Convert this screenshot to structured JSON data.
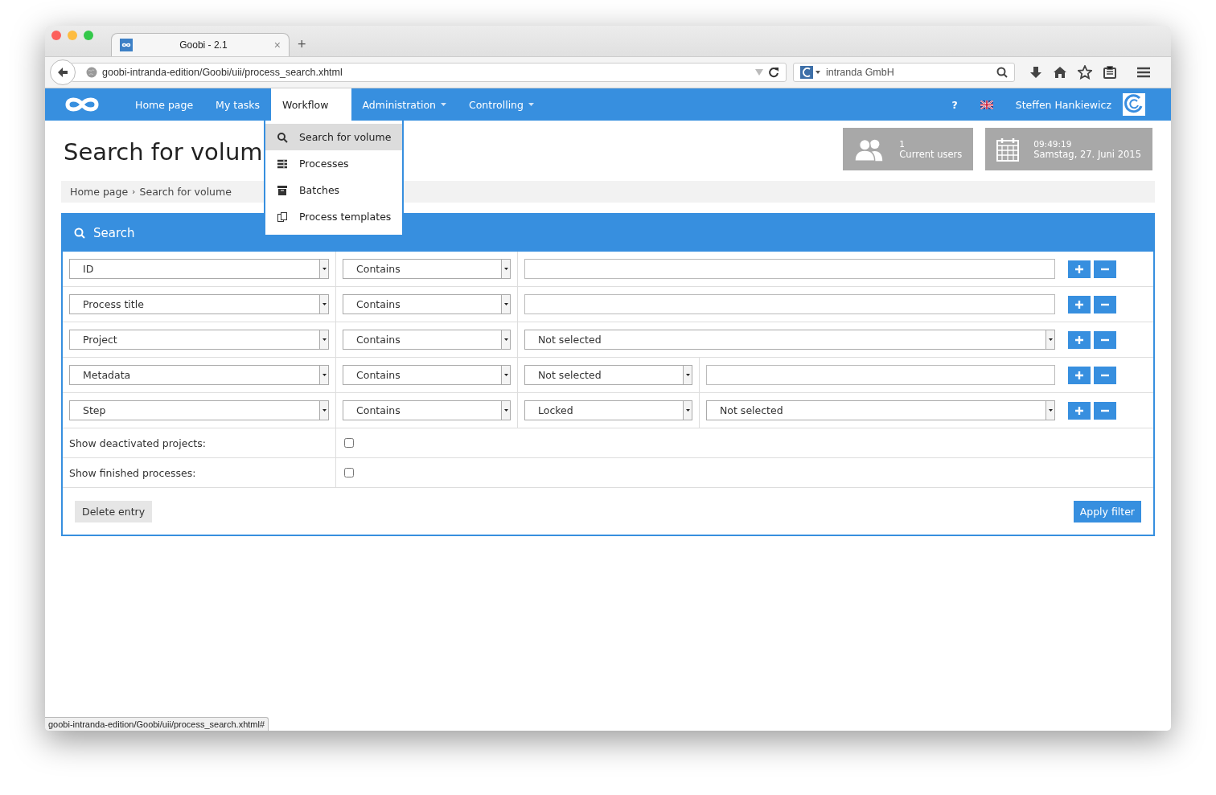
{
  "browser": {
    "tab_title": "Goobi - 2.1",
    "tab_close": "×",
    "new_tab": "+",
    "url": "goobi-intranda-edition/Goobi/uii/process_search.xhtml",
    "search_engine": "intranda GmbH",
    "status_url": "goobi-intranda-edition/Goobi/uii/process_search.xhtml#"
  },
  "navbar": {
    "items": [
      {
        "label": "Home page",
        "selected": false,
        "dropdown": false
      },
      {
        "label": "My tasks",
        "selected": false,
        "dropdown": false
      },
      {
        "label": "Workflow",
        "selected": true,
        "dropdown": false
      },
      {
        "label": "Administration",
        "selected": false,
        "dropdown": true
      },
      {
        "label": "Controlling",
        "selected": false,
        "dropdown": true
      }
    ],
    "help": "?",
    "user": "Steffen Hankiewicz"
  },
  "workflow_menu": {
    "items": [
      {
        "label": "Search for volume",
        "selected": true
      },
      {
        "label": "Processes",
        "selected": false
      },
      {
        "label": "Batches",
        "selected": false
      },
      {
        "label": "Process templates",
        "selected": false
      }
    ]
  },
  "page_title": "Search for volum",
  "info": {
    "users_count": "1",
    "users_label": "Current users",
    "time": "09:49:19",
    "date": "Samstag, 27. Juni 2015"
  },
  "breadcrumb": {
    "items": [
      "Home page",
      "Search for volume"
    ],
    "separator": "›"
  },
  "search": {
    "title": "Search",
    "rows": [
      {
        "field": "ID",
        "operator": "Contains",
        "values": [
          {
            "kind": "text"
          }
        ]
      },
      {
        "field": "Process title",
        "operator": "Contains",
        "values": [
          {
            "kind": "text"
          }
        ]
      },
      {
        "field": "Project",
        "operator": "Contains",
        "values": [
          {
            "kind": "select",
            "value": "Not selected"
          }
        ]
      },
      {
        "field": "Metadata",
        "operator": "Contains",
        "values": [
          {
            "kind": "select",
            "value": "Not selected"
          },
          {
            "kind": "text"
          }
        ]
      },
      {
        "field": "Step",
        "operator": "Contains",
        "values": [
          {
            "kind": "select",
            "value": "Locked"
          },
          {
            "kind": "select",
            "value": "Not selected"
          }
        ]
      }
    ],
    "options": [
      {
        "label": "Show deactivated projects:",
        "checked": false
      },
      {
        "label": "Show finished processes:",
        "checked": false
      }
    ],
    "delete_button": "Delete entry",
    "apply_button": "Apply filter"
  }
}
